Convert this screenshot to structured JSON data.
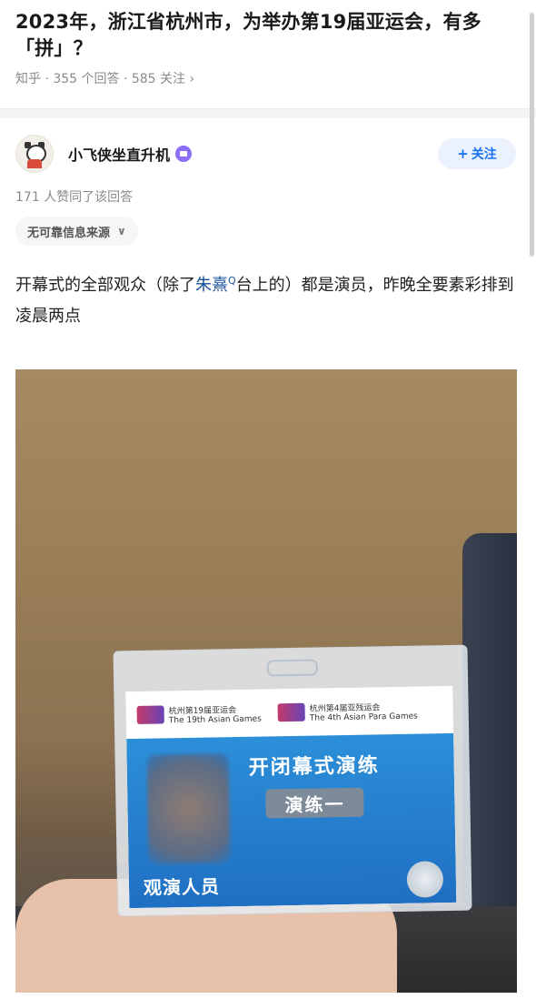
{
  "question": {
    "title": "2023年，浙江省杭州市，为举办第19届亚运会，有多「拼」？",
    "meta": "知乎 · 355 个回答 · 585 关注 ›"
  },
  "author": {
    "name": "小飞侠坐直升机",
    "follow_label": "关注",
    "follow_icon": "plus-icon"
  },
  "answer": {
    "votes": "171 人赞同了该回答",
    "tag": "无可靠信息来源",
    "text_before": "开幕式的全部观众（除了",
    "text_link": "朱熹",
    "text_after": "台上的）都是演员，昨晚全要素彩排到凌晨两点"
  },
  "photo_text": {
    "logo1": "杭州第19届亚运会",
    "logo1_en": "The 19th Asian Games",
    "logo2": "杭州第4届亚残运会",
    "logo2_en": "The 4th Asian Para Games",
    "card_title": "开闭幕式演练",
    "card_role": "演练一",
    "card_footer": "观演人员"
  },
  "colors": {
    "accent": "#1772f6",
    "link": "#175199"
  }
}
